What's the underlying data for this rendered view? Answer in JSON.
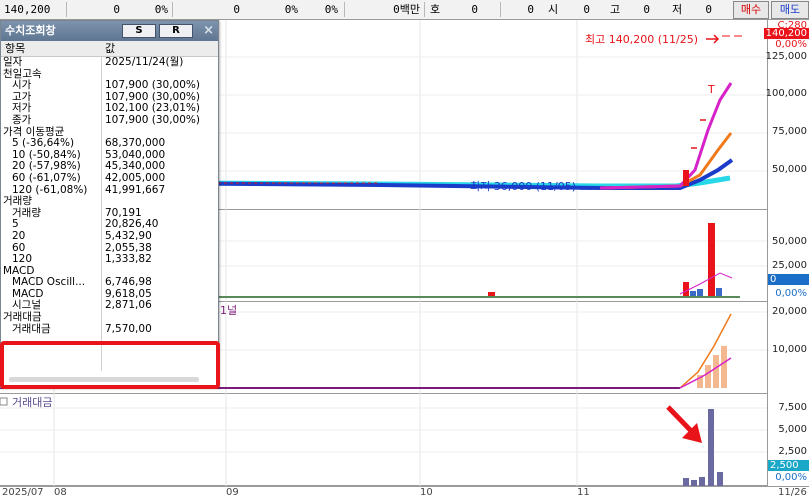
{
  "topbar": {
    "price": "140,200",
    "f1": "0",
    "f2": "0%",
    "f3": "0",
    "f4": "0%",
    "f5": "0%",
    "f6": "0백만",
    "f7": "호",
    "f8": "0",
    "f9": "시",
    "f10": "0",
    "f11": "고",
    "f12": "0",
    "f13": "저",
    "f14": "0",
    "buy_label": "매수",
    "sell_label": "매도"
  },
  "query_window": {
    "title": "수치조회창",
    "btn_s": "S",
    "btn_r": "R",
    "col_item": "항목",
    "col_value": "값",
    "rows": [
      {
        "k": "일자",
        "v": "2025/11/24(월)",
        "indent": false
      },
      {
        "k": "천일고속",
        "v": "",
        "indent": false
      },
      {
        "k": "시가",
        "v": "107,900 (30,00%)",
        "indent": true
      },
      {
        "k": "고가",
        "v": "107,900 (30,00%)",
        "indent": true
      },
      {
        "k": "저가",
        "v": "102,100 (23,01%)",
        "indent": true
      },
      {
        "k": "종가",
        "v": "107,900 (30,00%)",
        "indent": true
      },
      {
        "k": "가격 이동평균",
        "v": "",
        "indent": false
      },
      {
        "k": "5 (-36,64%)",
        "v": "68,370,000",
        "indent": true
      },
      {
        "k": "10 (-50,84%)",
        "v": "53,040,000",
        "indent": true
      },
      {
        "k": "20 (-57,98%)",
        "v": "45,340,000",
        "indent": true
      },
      {
        "k": "60 (-61,07%)",
        "v": "42,005,000",
        "indent": true
      },
      {
        "k": "120 (-61,08%)",
        "v": "41,991,667",
        "indent": true
      },
      {
        "k": "거래량",
        "v": "",
        "indent": false
      },
      {
        "k": "거래량",
        "v": "70,191",
        "indent": true
      },
      {
        "k": "5",
        "v": "20,826,40",
        "indent": true
      },
      {
        "k": "20",
        "v": "5,432,90",
        "indent": true
      },
      {
        "k": "60",
        "v": "2,055,38",
        "indent": true
      },
      {
        "k": "120",
        "v": "1,333,82",
        "indent": true
      },
      {
        "k": "MACD",
        "v": "",
        "indent": false
      },
      {
        "k": "MACD Oscill...",
        "v": "6,746,98",
        "indent": true
      },
      {
        "k": "MACD",
        "v": "9,618,05",
        "indent": true
      },
      {
        "k": "시그널",
        "v": "2,871,06",
        "indent": true
      },
      {
        "k": "거래대금",
        "v": "",
        "indent": false
      },
      {
        "k": "거래대금",
        "v": "7,570,00",
        "indent": true
      }
    ]
  },
  "price_pane": {
    "high_annotation": "최고 140,200 (11/25)",
    "low_annotation": "최저 36,000 (11/05)",
    "axis_top": "C:280",
    "axis_price": "140,200",
    "axis_pct": "0,00%",
    "ticks": [
      "125,000",
      "100,000",
      "75,000",
      "50,000"
    ],
    "marker_t": "T"
  },
  "volume_pane": {
    "ticks": [
      "50,000",
      "25,000"
    ],
    "axis_value": "0",
    "axis_pct": "0,00%"
  },
  "macd_pane": {
    "label_fragment": "1널",
    "ticks": [
      "20,000",
      "10,000"
    ]
  },
  "amount_pane": {
    "label": "거래대금",
    "ticks": [
      "7,500",
      "5,000",
      "2,500",
      "0,00%"
    ],
    "axis_value": "2,500"
  },
  "x_axis": {
    "labels": [
      "2025/07",
      "08",
      "09",
      "10",
      "11",
      "11/26"
    ]
  },
  "colors": {
    "up": "#e8141a",
    "down": "#1a3cc8",
    "ma5": "#e8141a",
    "ma10": "#d622c8",
    "ma20": "#f07a1a",
    "ma60": "#1a3cc8",
    "ma120": "#28d7e8",
    "macd": "#7a1a7a",
    "amount_bar": "#6a6aa0",
    "highlight": "#e8141a"
  }
}
